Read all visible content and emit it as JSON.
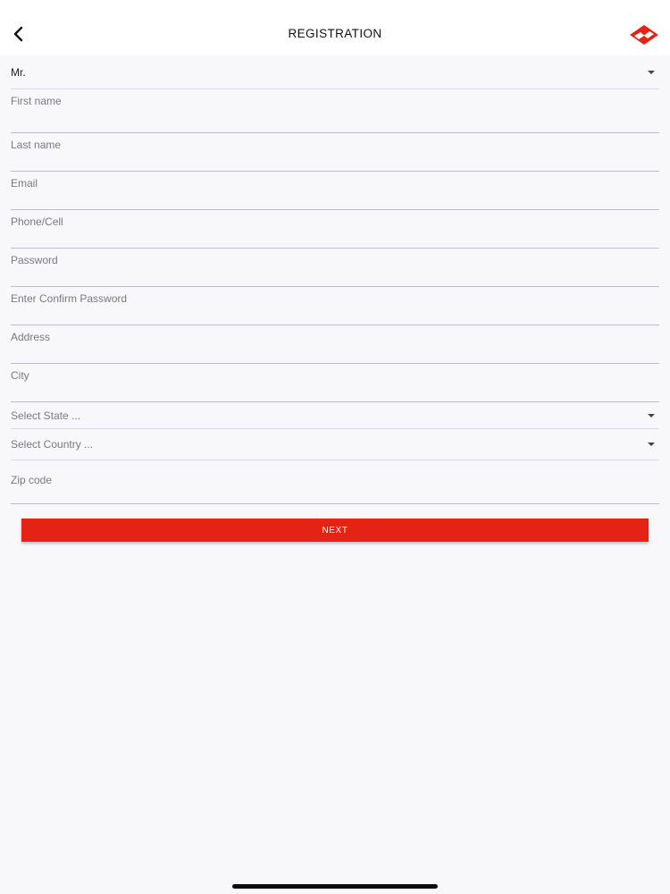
{
  "header": {
    "title": "REGISTRATION",
    "back_icon": "chevron-left-icon",
    "logo_icon": "brand-logo-icon",
    "logo_color": "#e52314"
  },
  "form": {
    "salutation": {
      "value": "Mr.",
      "icon": "caret-down-icon"
    },
    "first_name": {
      "placeholder": "First name"
    },
    "last_name": {
      "placeholder": "Last name"
    },
    "email": {
      "placeholder": "Email"
    },
    "phone": {
      "placeholder": "Phone/Cell"
    },
    "password": {
      "placeholder": "Password"
    },
    "confirm_password": {
      "placeholder": "Enter Confirm Password"
    },
    "address": {
      "placeholder": "Address"
    },
    "city": {
      "placeholder": "City"
    },
    "state": {
      "placeholder": "Select State ...",
      "icon": "caret-down-icon"
    },
    "country": {
      "placeholder": "Select Country ...",
      "icon": "caret-down-icon"
    },
    "zip": {
      "placeholder": "Zip code"
    }
  },
  "actions": {
    "next_label": "NEXT",
    "accent_color": "#e52314"
  }
}
